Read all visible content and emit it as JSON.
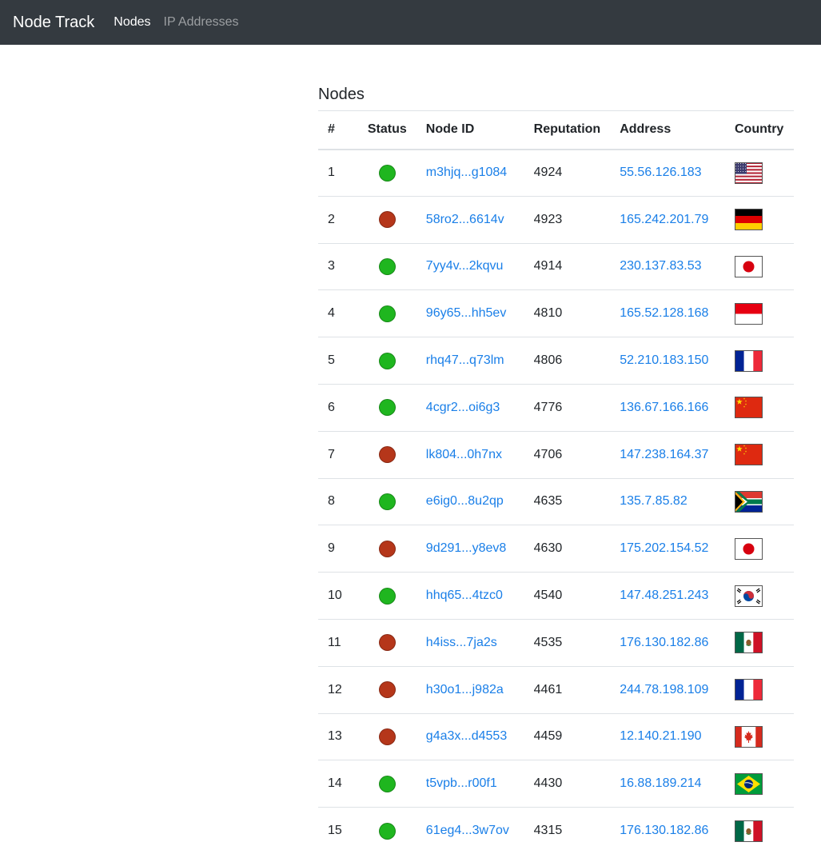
{
  "nav": {
    "brand": "Node Track",
    "links": [
      {
        "label": "Nodes",
        "active": true
      },
      {
        "label": "IP Addresses",
        "active": false
      }
    ]
  },
  "page": {
    "title": "Nodes"
  },
  "table": {
    "headers": [
      "#",
      "Status",
      "Node ID",
      "Reputation",
      "Address",
      "Country"
    ],
    "rows": [
      {
        "num": "1",
        "status": "online",
        "node_id": "m3hjq...g1084",
        "reputation": "4924",
        "address": "55.56.126.183",
        "country": "us"
      },
      {
        "num": "2",
        "status": "offline",
        "node_id": "58ro2...6614v",
        "reputation": "4923",
        "address": "165.242.201.79",
        "country": "de"
      },
      {
        "num": "3",
        "status": "online",
        "node_id": "7yy4v...2kqvu",
        "reputation": "4914",
        "address": "230.137.83.53",
        "country": "jp"
      },
      {
        "num": "4",
        "status": "online",
        "node_id": "96y65...hh5ev",
        "reputation": "4810",
        "address": "165.52.128.168",
        "country": "id"
      },
      {
        "num": "5",
        "status": "online",
        "node_id": "rhq47...q73lm",
        "reputation": "4806",
        "address": "52.210.183.150",
        "country": "fr"
      },
      {
        "num": "6",
        "status": "online",
        "node_id": "4cgr2...oi6g3",
        "reputation": "4776",
        "address": "136.67.166.166",
        "country": "cn"
      },
      {
        "num": "7",
        "status": "offline",
        "node_id": "lk804...0h7nx",
        "reputation": "4706",
        "address": "147.238.164.37",
        "country": "cn"
      },
      {
        "num": "8",
        "status": "online",
        "node_id": "e6ig0...8u2qp",
        "reputation": "4635",
        "address": "135.7.85.82",
        "country": "za"
      },
      {
        "num": "9",
        "status": "offline",
        "node_id": "9d291...y8ev8",
        "reputation": "4630",
        "address": "175.202.154.52",
        "country": "jp"
      },
      {
        "num": "10",
        "status": "online",
        "node_id": "hhq65...4tzc0",
        "reputation": "4540",
        "address": "147.48.251.243",
        "country": "kr"
      },
      {
        "num": "11",
        "status": "offline",
        "node_id": "h4iss...7ja2s",
        "reputation": "4535",
        "address": "176.130.182.86",
        "country": "mx"
      },
      {
        "num": "12",
        "status": "offline",
        "node_id": "h30o1...j982a",
        "reputation": "4461",
        "address": "244.78.198.109",
        "country": "fr"
      },
      {
        "num": "13",
        "status": "offline",
        "node_id": "g4a3x...d4553",
        "reputation": "4459",
        "address": "12.140.21.190",
        "country": "ca"
      },
      {
        "num": "14",
        "status": "online",
        "node_id": "t5vpb...r00f1",
        "reputation": "4430",
        "address": "16.88.189.214",
        "country": "br"
      },
      {
        "num": "15",
        "status": "online",
        "node_id": "61eg4...3w7ov",
        "reputation": "4315",
        "address": "176.130.182.86",
        "country": "mx"
      }
    ]
  },
  "colors": {
    "navbar_bg": "#343a40",
    "link": "#1a7fe8",
    "status_online": "#1fb61f",
    "status_offline": "#b5361a"
  }
}
